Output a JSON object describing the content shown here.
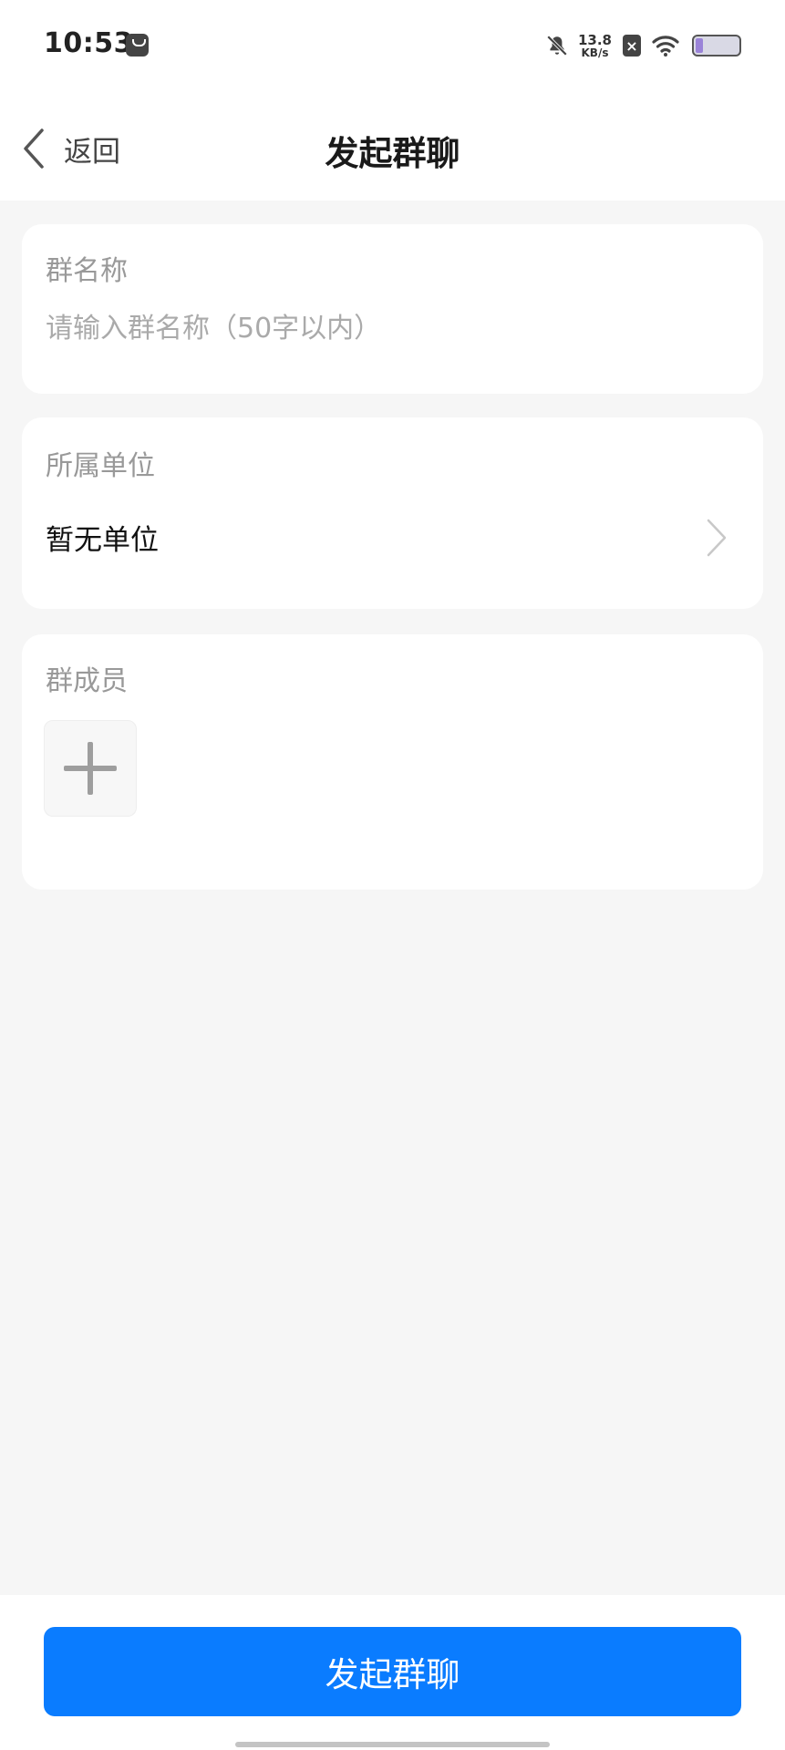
{
  "status_bar": {
    "time": "10:53",
    "net_speed_value": "13.8",
    "net_speed_unit": "KB/s",
    "icons": [
      "app-notification-icon",
      "muted-bell-icon",
      "no-sim-icon",
      "wifi-icon",
      "battery-icon"
    ],
    "battery_level": 0.18
  },
  "header": {
    "back_label": "返回",
    "title": "发起群聊"
  },
  "group_name": {
    "label": "群名称",
    "value": "",
    "placeholder": "请输入群名称（50字以内）"
  },
  "unit": {
    "label": "所属单位",
    "value": "暂无单位"
  },
  "members": {
    "label": "群成员"
  },
  "submit": {
    "label": "发起群聊"
  },
  "colors": {
    "primary": "#0a7cff",
    "page_background": "#f6f6f6",
    "card_background": "#ffffff",
    "label_gray": "#999999"
  }
}
